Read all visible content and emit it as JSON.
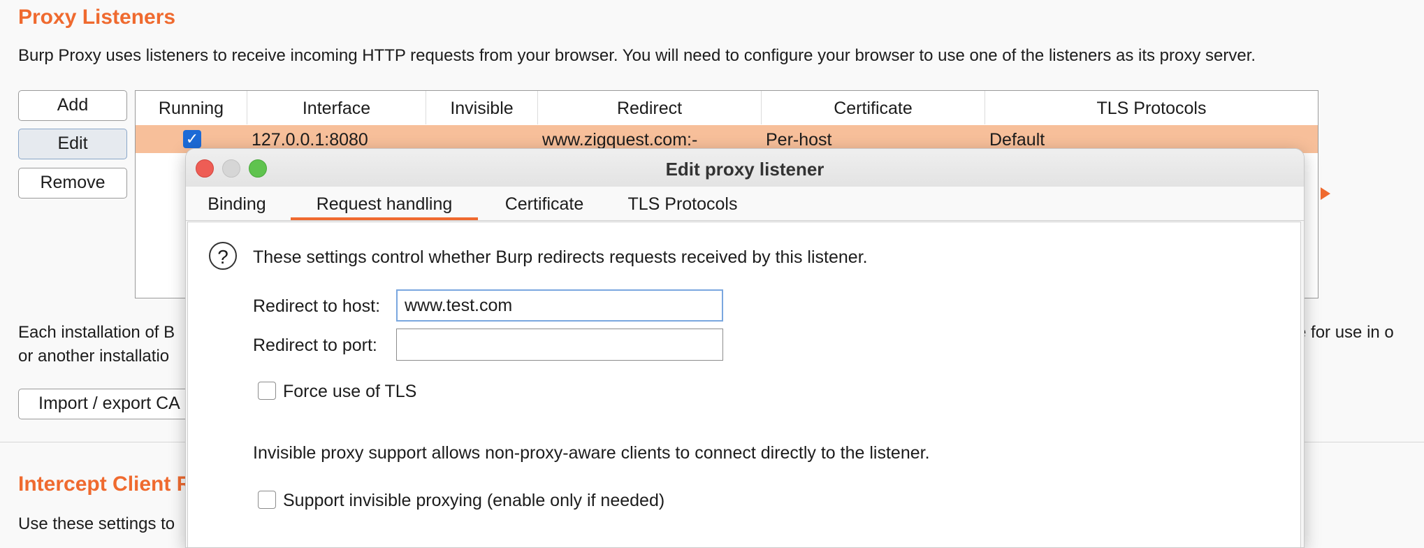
{
  "proxy_listeners": {
    "title": "Proxy Listeners",
    "description": "Burp Proxy uses listeners to receive incoming HTTP requests from your browser. You will need to configure your browser to use one of the listeners as its proxy server.",
    "buttons": {
      "add": "Add",
      "edit": "Edit",
      "remove": "Remove"
    },
    "table": {
      "columns": [
        "Running",
        "Interface",
        "Invisible",
        "Redirect",
        "Certificate",
        "TLS Protocols"
      ],
      "rows": [
        {
          "running": true,
          "interface": "127.0.0.1:8080",
          "invisible": "",
          "redirect": "www.zigquest.com:-",
          "certificate": "Per-host",
          "tls_protocols": "Default"
        }
      ]
    },
    "ca_text_line1": "Each installation of B",
    "ca_text_line1_right": "ate for use in o",
    "ca_text_line2": "or another installatio",
    "import_export_label": "Import / export CA"
  },
  "intercept_client": {
    "title": "Intercept Client R",
    "description": "Use these settings to"
  },
  "dialog": {
    "title": "Edit proxy listener",
    "tabs": [
      "Binding",
      "Request handling",
      "Certificate",
      "TLS Protocols"
    ],
    "active_tab": "Request handling",
    "help_text": "These settings control whether Burp redirects requests received by this listener.",
    "redirect_host_label": "Redirect to host:",
    "redirect_host_value": "www.test.com",
    "redirect_port_label": "Redirect to port:",
    "redirect_port_value": "",
    "force_tls_label": "Force use of TLS",
    "force_tls_checked": false,
    "invisible_text": "Invisible proxy support allows non-proxy-aware clients to connect directly to the listener.",
    "invisible_label": "Support invisible proxying (enable only if needed)",
    "invisible_checked": false
  },
  "colors": {
    "accent": "#ef6a2f",
    "selection": "#f7bf9a",
    "checkbox_blue": "#1c6ad6"
  }
}
